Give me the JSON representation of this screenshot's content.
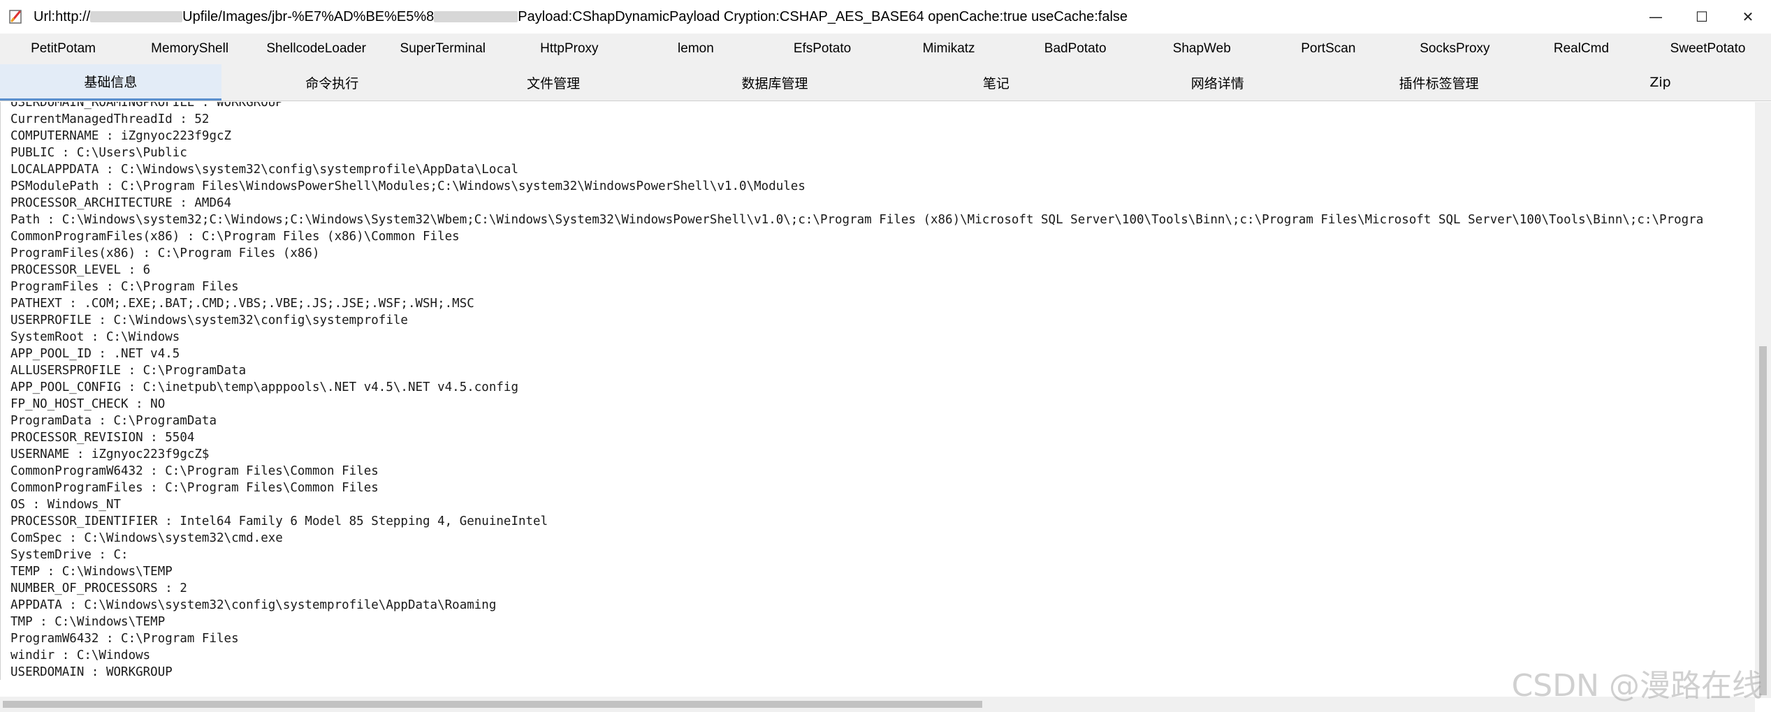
{
  "window": {
    "title_prefix": "Url:http://",
    "title_mid": "Upfile/Images/jbr-%E7%AD%BE%E5%8",
    "title_suffix": "Payload:CShapDynamicPayload Cryption:CSHAP_AES_BASE64 openCache:true useCache:false",
    "minimize_glyph": "—",
    "maximize_glyph": "☐",
    "close_glyph": "✕"
  },
  "plugins": [
    "PetitPotam",
    "MemoryShell",
    "ShellcodeLoader",
    "SuperTerminal",
    "HttpProxy",
    "lemon",
    "EfsPotato",
    "Mimikatz",
    "BadPotato",
    "ShapWeb",
    "PortScan",
    "SocksProxy",
    "RealCmd",
    "SweetPotato"
  ],
  "func_tabs": [
    "基础信息",
    "命令执行",
    "文件管理",
    "数据库管理",
    "笔记",
    "网络详情",
    "插件标签管理",
    "Zip"
  ],
  "active_func_tab": 0,
  "lines": [
    "USERDOMAIN_ROAMINGPROFILE : WORKGROUP",
    "CurrentManagedThreadId : 52",
    "COMPUTERNAME : iZgnyoc223f9gcZ",
    "PUBLIC : C:\\Users\\Public",
    "LOCALAPPDATA : C:\\Windows\\system32\\config\\systemprofile\\AppData\\Local",
    "PSModulePath : C:\\Program Files\\WindowsPowerShell\\Modules;C:\\Windows\\system32\\WindowsPowerShell\\v1.0\\Modules",
    "PROCESSOR_ARCHITECTURE : AMD64",
    "Path : C:\\Windows\\system32;C:\\Windows;C:\\Windows\\System32\\Wbem;C:\\Windows\\System32\\WindowsPowerShell\\v1.0\\;c:\\Program Files (x86)\\Microsoft SQL Server\\100\\Tools\\Binn\\;c:\\Program Files\\Microsoft SQL Server\\100\\Tools\\Binn\\;c:\\Progra",
    "CommonProgramFiles(x86) : C:\\Program Files (x86)\\Common Files",
    "ProgramFiles(x86) : C:\\Program Files (x86)",
    "PROCESSOR_LEVEL : 6",
    "ProgramFiles : C:\\Program Files",
    "PATHEXT : .COM;.EXE;.BAT;.CMD;.VBS;.VBE;.JS;.JSE;.WSF;.WSH;.MSC",
    "USERPROFILE : C:\\Windows\\system32\\config\\systemprofile",
    "SystemRoot : C:\\Windows",
    "APP_POOL_ID : .NET v4.5",
    "ALLUSERSPROFILE : C:\\ProgramData",
    "APP_POOL_CONFIG : C:\\inetpub\\temp\\apppools\\.NET v4.5\\.NET v4.5.config",
    "FP_NO_HOST_CHECK : NO",
    "ProgramData : C:\\ProgramData",
    "PROCESSOR_REVISION : 5504",
    "USERNAME : iZgnyoc223f9gcZ$",
    "CommonProgramW6432 : C:\\Program Files\\Common Files",
    "CommonProgramFiles : C:\\Program Files\\Common Files",
    "OS : Windows_NT",
    "PROCESSOR_IDENTIFIER : Intel64 Family 6 Model 85 Stepping 4, GenuineIntel",
    "ComSpec : C:\\Windows\\system32\\cmd.exe",
    "SystemDrive : C:",
    "TEMP : C:\\Windows\\TEMP",
    "NUMBER_OF_PROCESSORS : 2",
    "APPDATA : C:\\Windows\\system32\\config\\systemprofile\\AppData\\Roaming",
    "TMP : C:\\Windows\\TEMP",
    "ProgramW6432 : C:\\Program Files",
    "windir : C:\\Windows",
    "USERDOMAIN : WORKGROUP"
  ],
  "watermark": "CSDN @漫路在线"
}
